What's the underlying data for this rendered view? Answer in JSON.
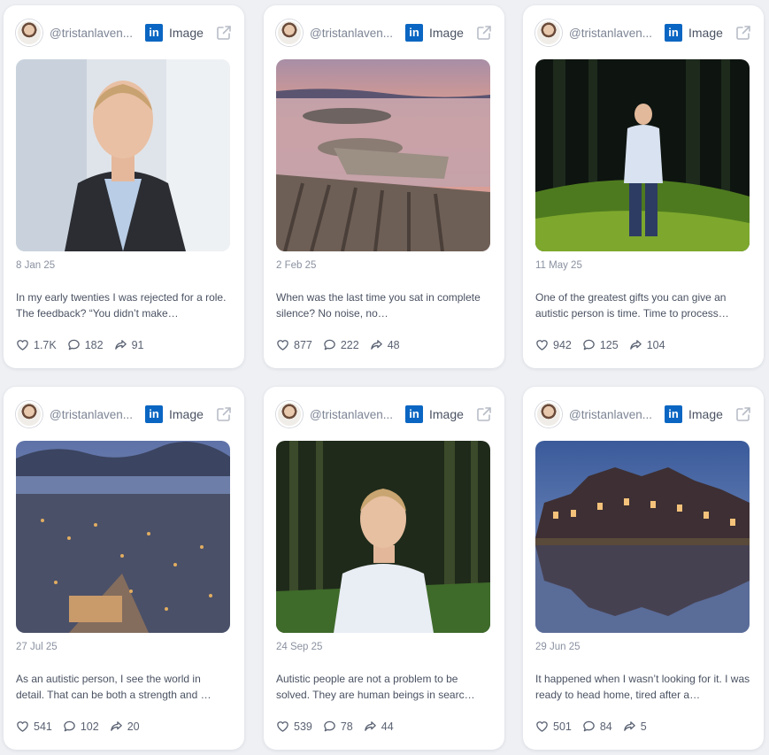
{
  "cards": [
    {
      "handle": "@tristanlaven...",
      "platform_icon": "linkedin-icon",
      "type": "Image",
      "date": "8 Jan 25",
      "text": "In my early twenties I was rejected for a role. The feedback? “You didn’t make…",
      "likes": "1.7K",
      "comments": "182",
      "shares": "91",
      "image": "portrait-suit"
    },
    {
      "handle": "@tristanlaven...",
      "platform_icon": "linkedin-icon",
      "type": "Image",
      "date": "2 Feb 25",
      "text": "When was the last time you sat in complete silence? No noise, no…",
      "likes": "877",
      "comments": "222",
      "shares": "48",
      "image": "lake-rocks"
    },
    {
      "handle": "@tristanlaven...",
      "platform_icon": "linkedin-icon",
      "type": "Image",
      "date": "11 May 25",
      "text": "One of the greatest gifts you can give an autistic person is time. Time to process…",
      "likes": "942",
      "comments": "125",
      "shares": "104",
      "image": "man-forest-night"
    },
    {
      "handle": "@tristanlaven...",
      "platform_icon": "linkedin-icon",
      "type": "Image",
      "date": "27 Jul 25",
      "text": "As an autistic person, I see the world in detail. That can be both a strength and …",
      "likes": "541",
      "comments": "102",
      "shares": "20",
      "image": "city-dusk"
    },
    {
      "handle": "@tristanlaven...",
      "platform_icon": "linkedin-icon",
      "type": "Image",
      "date": "24 Sep 25",
      "text": "Autistic people are not a problem to be solved. They are human beings in searc…",
      "likes": "539",
      "comments": "78",
      "shares": "44",
      "image": "portrait-forest"
    },
    {
      "handle": "@tristanlaven...",
      "platform_icon": "linkedin-icon",
      "type": "Image",
      "date": "29 Jun 25",
      "text": "It happened when I wasn’t looking for it. I was ready to head home, tired after a…",
      "likes": "501",
      "comments": "84",
      "shares": "5",
      "image": "houses-reflection"
    }
  ],
  "colors": {
    "background": "#eef0f4",
    "card": "#ffffff",
    "linkedin": "#0a66c2",
    "muted_text": "#8a91a0"
  }
}
